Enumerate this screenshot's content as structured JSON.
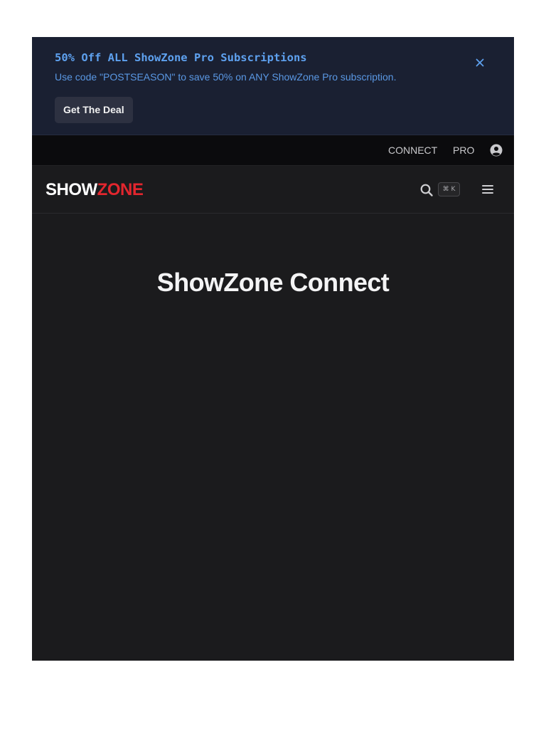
{
  "promo": {
    "title": "50% Off ALL ShowZone Pro Subscriptions",
    "subtitle": "Use code \"POSTSEASON\" to save 50% on ANY ShowZone Pro subscription.",
    "cta_label": "Get The Deal",
    "close_icon": "close-icon"
  },
  "topbar": {
    "links": {
      "connect": "CONNECT",
      "pro": "PRO"
    },
    "user_icon": "user-circle-icon"
  },
  "nav": {
    "logo": {
      "part1": "SHOW",
      "part2": "ZONE"
    },
    "search_icon": "search-icon",
    "search_shortcut": "⌘ K",
    "menu_icon": "hamburger-menu-icon"
  },
  "hero": {
    "title": "ShowZone Connect"
  },
  "colors": {
    "banner_bg": "#1a2032",
    "banner_text": "#5ea1ef",
    "topbar_bg": "#0b0b0d",
    "page_bg": "#1b1b1d",
    "brand_red": "#e3262e"
  }
}
